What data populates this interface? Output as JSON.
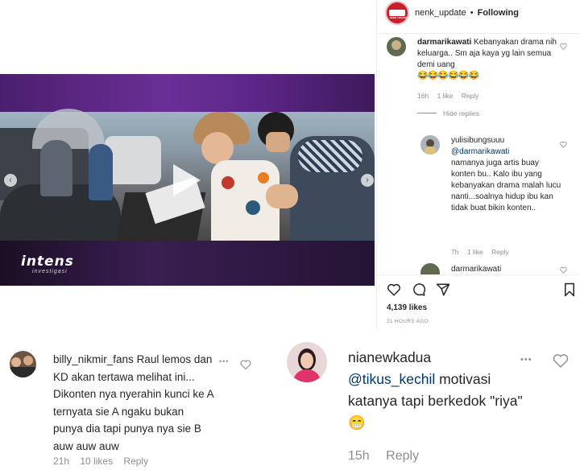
{
  "post": {
    "username": "nenk_update",
    "separator": "•",
    "follow_status": "Following",
    "avatar_text": "NENK UPDATE"
  },
  "video": {
    "brand": "intens",
    "brand_sub": "investigasi"
  },
  "comments": [
    {
      "username": "darmarikawati",
      "text": "Kebanyakan drama nih keluarga.. Sm aja kaya yg lain semua demi uang",
      "emojis": "😂😂😂😂😂😂",
      "time": "16h",
      "likes": "1 like",
      "reply": "Reply",
      "hide_replies": "Hide replies"
    },
    {
      "username": "yulisibungsuuu",
      "mention": "@darmarikawati",
      "text": "namanya juga artis buay konten bu.. Kalo ibu yang kebanyakan drama malah lucu nanti...soalnya hidup ibu kan tidak buat bikin konten..",
      "time": "7h",
      "likes": "1 like",
      "reply": "Reply"
    },
    {
      "username": "darmarikawati"
    }
  ],
  "actions": {
    "likes": "4,139 likes",
    "time_ago": "21 HOURS AGO"
  },
  "bottom_left": {
    "username": "billy_nikmir_fans",
    "text": "Raul lemos dan KD akan tertawa melihat ini... Dikonten nya nyerahin kunci ke A ternyata sie A ngaku bukan punya dia tapi punya nya sie B auw auw auw",
    "time": "21h",
    "likes": "10 likes",
    "reply": "Reply",
    "more": "•••"
  },
  "bottom_right": {
    "username": "nianewkadua",
    "mention": "@tikus_kechil",
    "text": "motivasi katanya tapi berkedok \"riya\"",
    "emoji": "😁",
    "time": "15h",
    "reply": "Reply",
    "more": "•••"
  },
  "colors": {
    "link": "#00376b",
    "purple": "#5a2686",
    "meta": "#8e8e8e"
  }
}
